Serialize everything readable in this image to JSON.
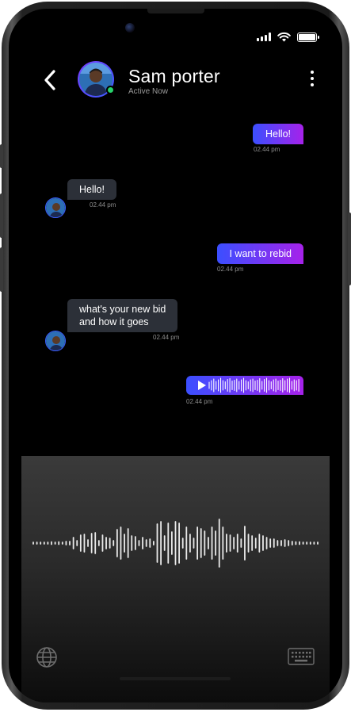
{
  "header": {
    "contact_name": "Sam porter",
    "contact_status": "Active Now"
  },
  "messages": [
    {
      "direction": "outgoing",
      "type": "text",
      "text": "Hello!",
      "time": "02.44 pm"
    },
    {
      "direction": "incoming",
      "type": "text",
      "text": "Hello!",
      "time": "02.44 pm"
    },
    {
      "direction": "outgoing",
      "type": "text",
      "text": "I want to rebid",
      "time": "02.44 pm"
    },
    {
      "direction": "incoming",
      "type": "text",
      "text_line1": "what's your new bid",
      "text_line2": "and how it goes",
      "time": "02.44 pm"
    },
    {
      "direction": "outgoing",
      "type": "voice",
      "time": "02.44 pm"
    }
  ],
  "colors": {
    "outgoing_gradient_start": "#3b4fff",
    "outgoing_gradient_end": "#a622ea",
    "incoming_bubble": "#2c3038",
    "online": "#27d36b"
  },
  "icons": {
    "back": "chevron-left-icon",
    "menu": "more-vertical-icon",
    "play": "play-icon",
    "globe": "globe-icon",
    "keyboard": "keyboard-icon"
  }
}
